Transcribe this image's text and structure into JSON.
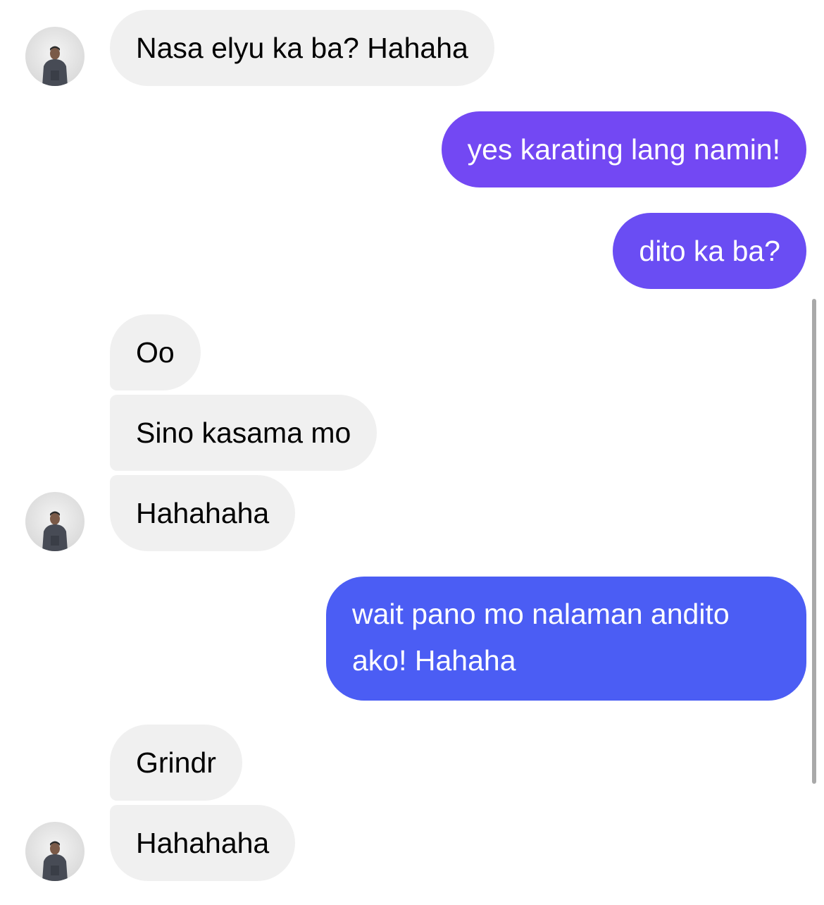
{
  "conversation": {
    "messages": [
      {
        "text": "Nasa elyu ka ba? Hahaha"
      },
      {
        "text": "yes karating lang namin!"
      },
      {
        "text": "dito ka ba?"
      },
      {
        "text": "Oo"
      },
      {
        "text": "Sino kasama mo"
      },
      {
        "text": "Hahahaha"
      },
      {
        "text": "wait pano mo nalaman andito ako! Hahaha"
      },
      {
        "text": "Grindr"
      },
      {
        "text": "Hahahaha"
      }
    ]
  },
  "colors": {
    "incoming_bubble": "#f0f0f0",
    "incoming_text": "#000000",
    "outgoing_text": "#ffffff",
    "outgoing_gradient_top": "#7a48f2",
    "outgoing_gradient_bottom": "#4a60f4",
    "background": "#ffffff"
  },
  "icons": {
    "avatar": "contact-avatar-photo"
  }
}
